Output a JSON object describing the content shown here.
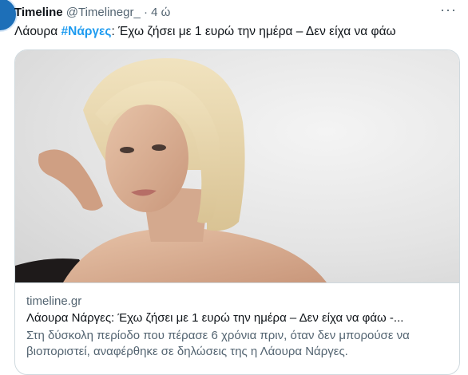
{
  "tweet": {
    "author_name": "Timeline",
    "author_handle": "@Timelinegr_",
    "separator": " · ",
    "time": "4 ώ",
    "more_label": "···",
    "text_before": "Λάουρα ",
    "hashtag": "#Νάργες",
    "text_after": ": Έχω ζήσει με 1 ευρώ την ημέρα – Δεν είχα να φάω"
  },
  "card": {
    "domain": "timeline.gr",
    "title": "Λάουρα Νάργες: Έχω ζήσει με 1 ευρώ την ημέρα – Δεν είχα να φάω -...",
    "description": "Στη δύσκολη περίοδο που πέρασε 6 χρόνια πριν, όταν δεν μπορούσε να βιοποριστεί, αναφέρθηκε σε δηλώσεις της η Λάουρα Νάργες."
  },
  "colors": {
    "link": "#1d9bf0",
    "secondary_text": "#536471",
    "border": "#cfd9de",
    "avatar": "#1d6fb8"
  }
}
